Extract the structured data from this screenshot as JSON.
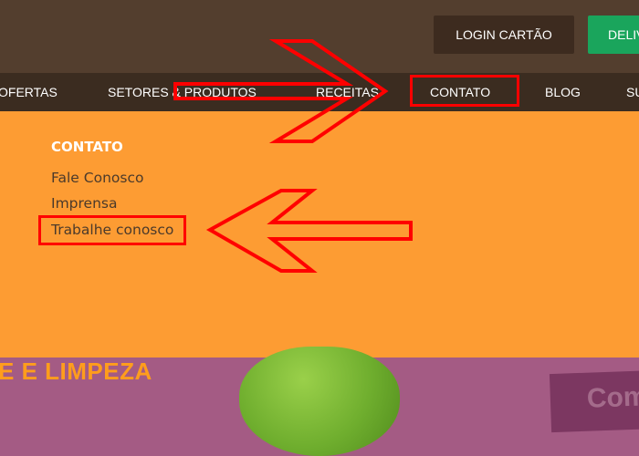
{
  "header": {
    "login_label": "LOGIN CARTÃO",
    "delivery_label": "DELIV"
  },
  "nav": {
    "items": [
      "OFERTAS",
      "SETORES & PRODUTOS",
      "RECEITAS",
      "CONTATO",
      "BLOG",
      "SU"
    ]
  },
  "dropdown": {
    "heading": "CONTATO",
    "links": [
      "Fale Conosco",
      "Imprensa",
      "Trabalhe conosco"
    ]
  },
  "hero": {
    "text": "E E LIMPEZA",
    "badge": "Com"
  },
  "colors": {
    "topbar": "#533e2e",
    "navbar": "#3b2c20",
    "dropdown": "#fd9c33",
    "highlight": "#ff0000",
    "delivery": "#1aa55c"
  }
}
